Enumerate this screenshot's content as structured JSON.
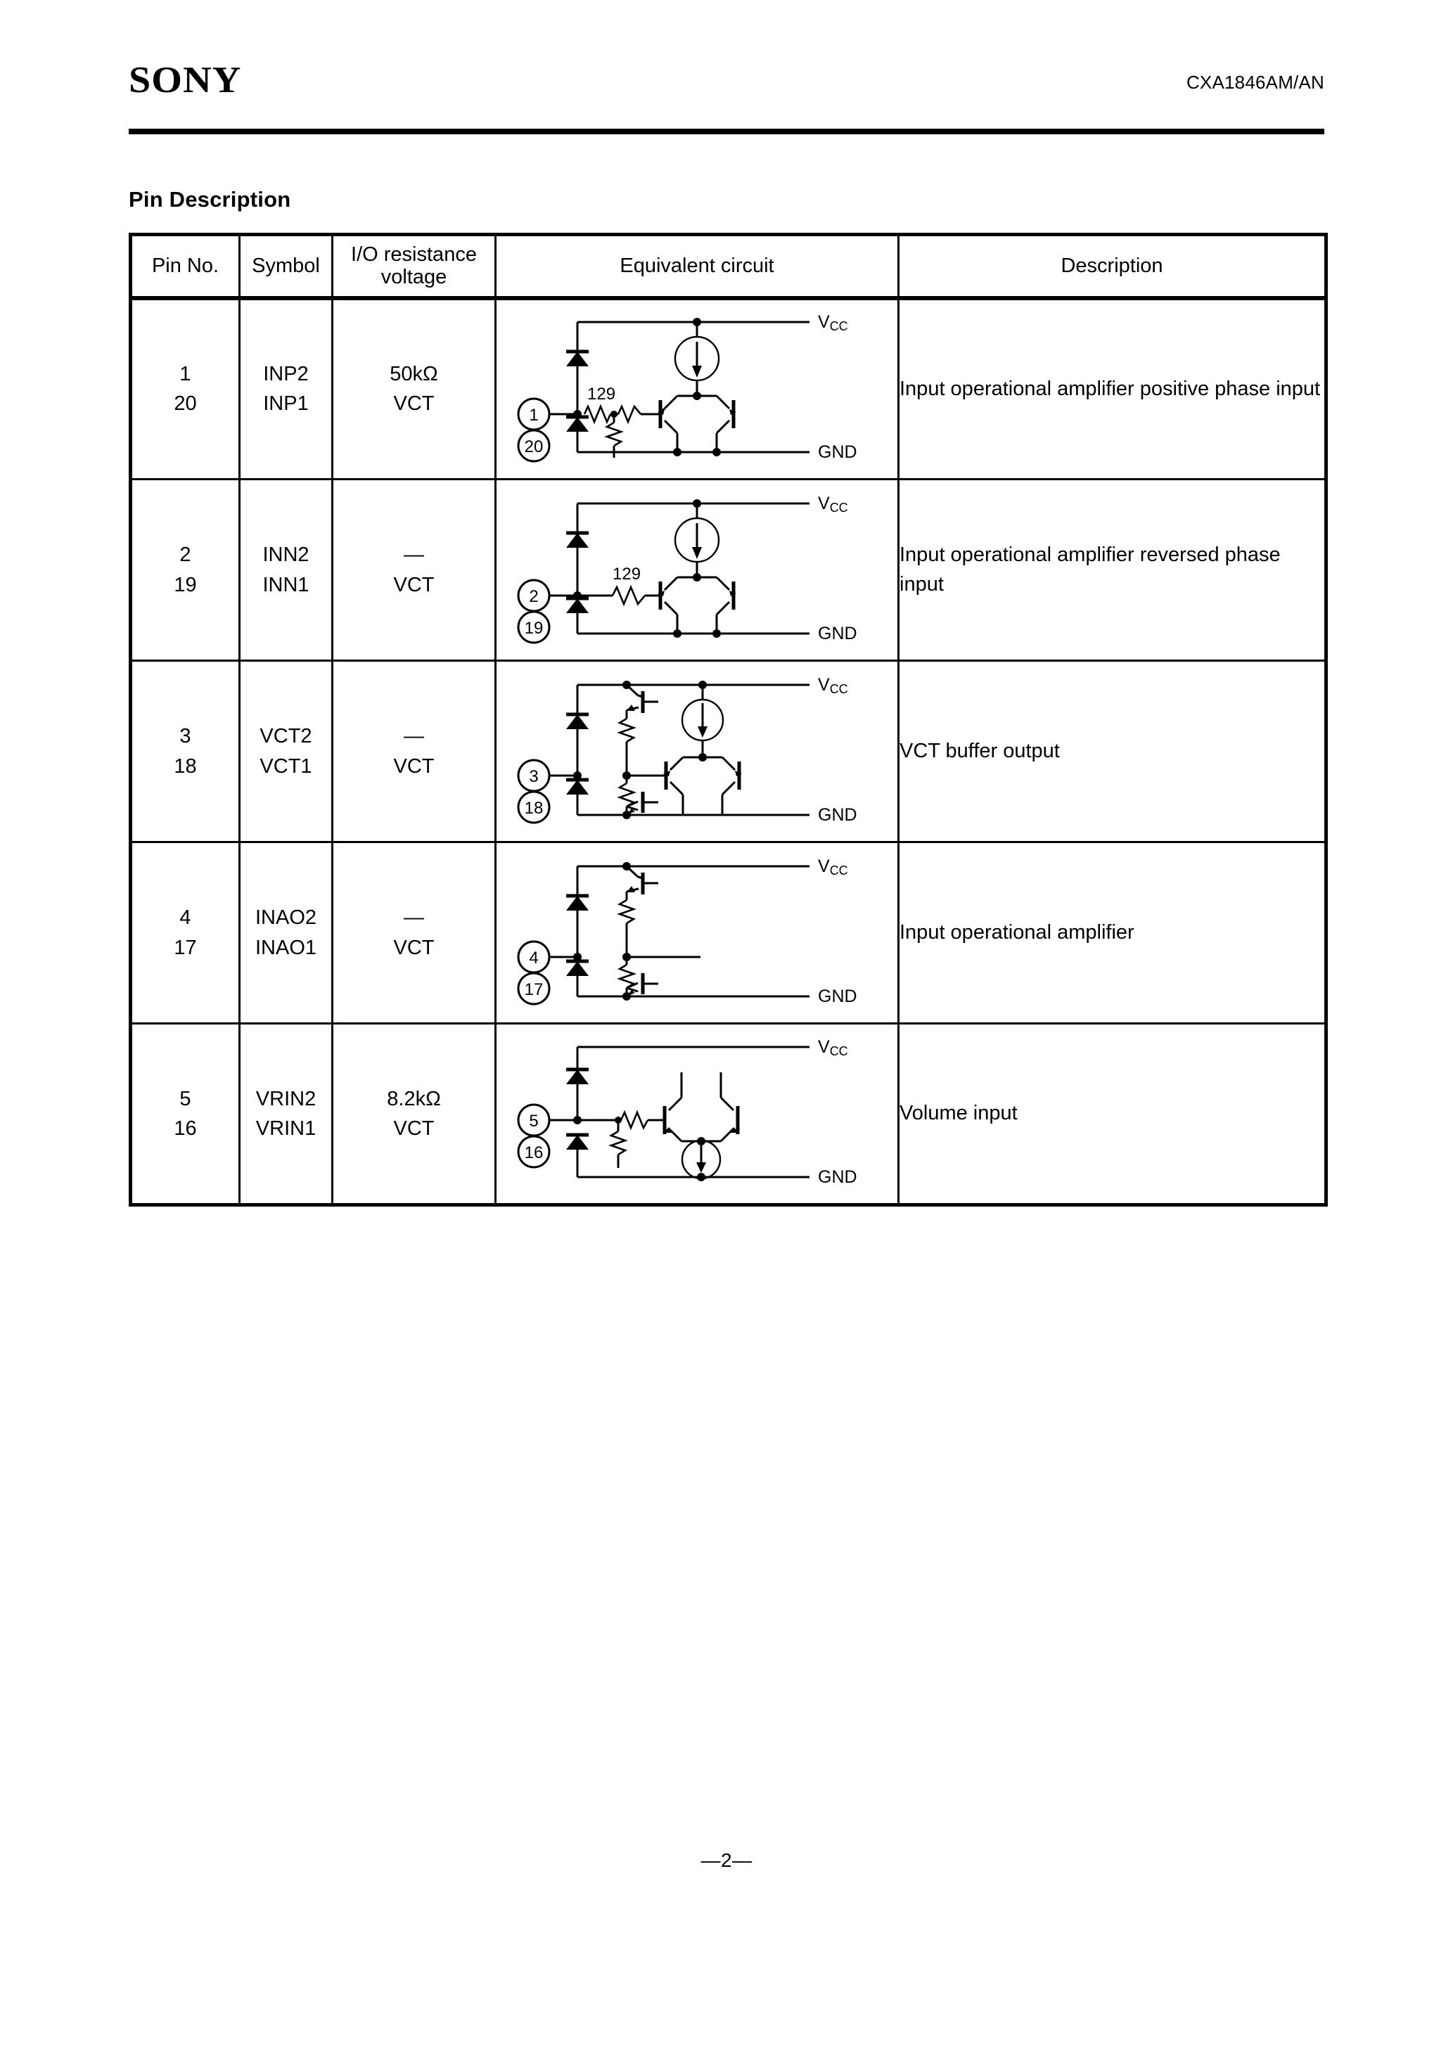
{
  "header": {
    "logo": "SONY",
    "part_number": "CXA1846AM/AN"
  },
  "section": {
    "title": "Pin Description"
  },
  "table": {
    "columns": [
      "Pin No.",
      "Symbol",
      "I/O resistance\nvoltage",
      "Equivalent circuit",
      "Description"
    ],
    "rows": [
      {
        "pin_no": "1\n20",
        "symbol": "INP2\nINP1",
        "io_resistance_voltage": "50kΩ\nVCT",
        "description": "Input operational amplifier positive phase input",
        "circuit": {
          "pin_labels": [
            "1",
            "20"
          ],
          "resistor_label": "129",
          "rails": [
            "Vcc",
            "GND"
          ],
          "elements": [
            "esd-diode-upper",
            "esd-diode-lower",
            "series-resistor-split",
            "shunt-resistor",
            "pnp-differential-pair",
            "current-source-from-vcc"
          ]
        }
      },
      {
        "pin_no": "2\n19",
        "symbol": "INN2\nINN1",
        "io_resistance_voltage": "—\nVCT",
        "description": "Input operational amplifier reversed phase input",
        "circuit": {
          "pin_labels": [
            "2",
            "19"
          ],
          "resistor_label": "129",
          "rails": [
            "Vcc",
            "GND"
          ],
          "elements": [
            "esd-diode-upper",
            "esd-diode-lower",
            "series-resistor",
            "pnp-differential-pair",
            "current-source-from-vcc"
          ]
        }
      },
      {
        "pin_no": "3\n18",
        "symbol": "VCT2\nVCT1",
        "io_resistance_voltage": "—\nVCT",
        "description": "VCT buffer output",
        "circuit": {
          "pin_labels": [
            "3",
            "18"
          ],
          "resistor_label": "",
          "rails": [
            "Vcc",
            "GND"
          ],
          "elements": [
            "esd-diode-upper",
            "esd-diode-lower",
            "push-pull-output",
            "pnp-differential-pair",
            "current-source-from-vcc"
          ]
        }
      },
      {
        "pin_no": "4\n17",
        "symbol": "INAO2\nINAO1",
        "io_resistance_voltage": "—\nVCT",
        "description": "Input operational amplifier",
        "circuit": {
          "pin_labels": [
            "4",
            "17"
          ],
          "resistor_label": "",
          "rails": [
            "Vcc",
            "GND"
          ],
          "elements": [
            "esd-diode-upper",
            "esd-diode-lower",
            "push-pull-output"
          ]
        }
      },
      {
        "pin_no": "5\n16",
        "symbol": "VRIN2\nVRIN1",
        "io_resistance_voltage": "8.2kΩ\nVCT",
        "description": "Volume input",
        "circuit": {
          "pin_labels": [
            "5",
            "16"
          ],
          "resistor_label": "",
          "rails": [
            "Vcc",
            "GND"
          ],
          "elements": [
            "esd-diode-upper",
            "esd-diode-lower",
            "series-resistor",
            "shunt-resistor",
            "npn-differential-pair",
            "current-source-to-gnd"
          ]
        }
      }
    ]
  },
  "footer": {
    "page_marker": "—2—"
  },
  "colors": {
    "ink": "#000000",
    "paper": "#ffffff"
  }
}
